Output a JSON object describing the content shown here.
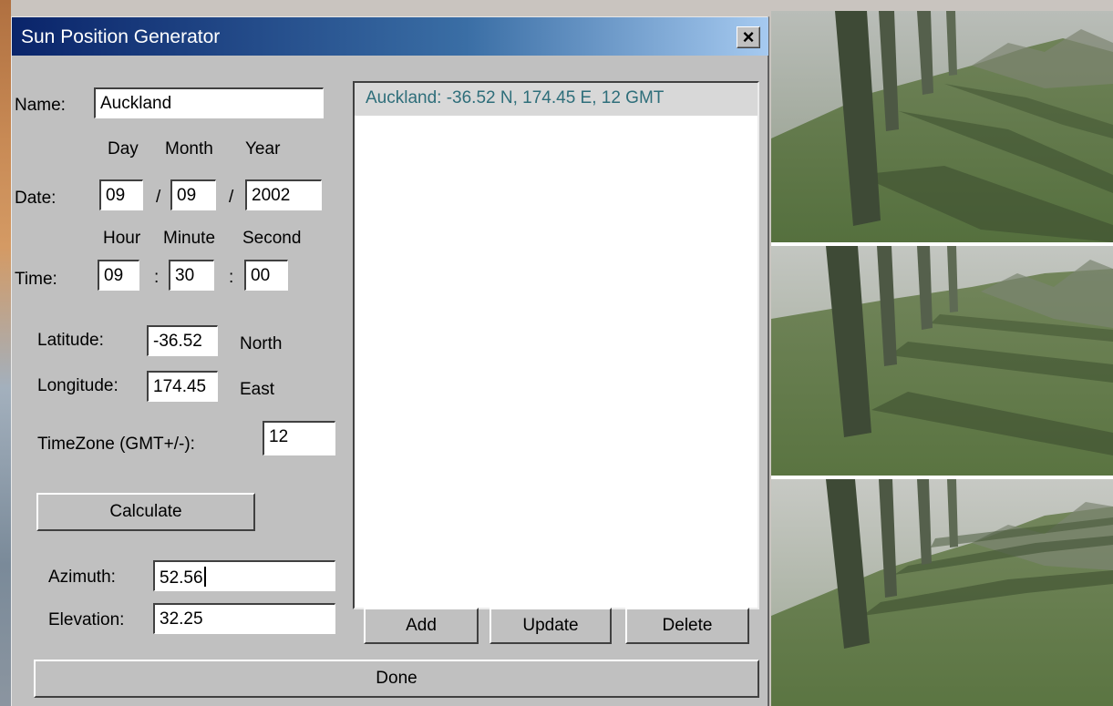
{
  "window": {
    "title": "Sun Position Generator",
    "close_glyph": "×"
  },
  "form": {
    "name_label": "Name:",
    "name_value": "Auckland",
    "date_headers": {
      "day": "Day",
      "month": "Month",
      "year": "Year"
    },
    "date_label": "Date:",
    "date_day": "09",
    "date_month": "09",
    "date_year": "2002",
    "date_separator": "/",
    "time_headers": {
      "hour": "Hour",
      "minute": "Minute",
      "second": "Second"
    },
    "time_label": "Time:",
    "time_hour": "09",
    "time_minute": "30",
    "time_second": "00",
    "time_separator": ":",
    "latitude_label": "Latitude:",
    "latitude_value": "-36.52",
    "latitude_dir": "North",
    "longitude_label": "Longitude:",
    "longitude_value": "174.45",
    "longitude_dir": "East",
    "timezone_label": "TimeZone (GMT+/-):",
    "timezone_value": "12",
    "calculate_label": "Calculate",
    "azimuth_label": "Azimuth:",
    "azimuth_value": "52.56",
    "elevation_label": "Elevation:",
    "elevation_value": "32.25"
  },
  "list": {
    "items": [
      "Auckland: -36.52 N, 174.45 E, 12 GMT"
    ]
  },
  "buttons": {
    "add": "Add",
    "update": "Update",
    "delete": "Delete",
    "done": "Done"
  },
  "colors": {
    "titlebar_start": "#0a246a",
    "titlebar_end": "#a6caf0",
    "dialog_face": "#c0c0c0",
    "list_item_text": "#2e6e7a",
    "list_item_bg": "#d8d8d8"
  }
}
